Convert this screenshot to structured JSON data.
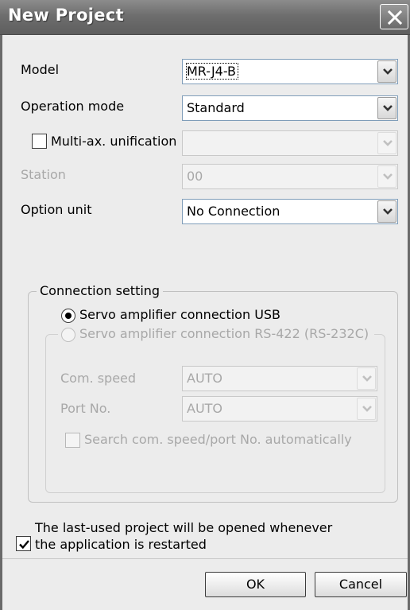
{
  "dialog": {
    "title": "New Project"
  },
  "fields": {
    "model": {
      "label": "Model",
      "value": "MR-J4-B"
    },
    "operation_mode": {
      "label": "Operation mode",
      "value": "Standard"
    },
    "multi_axis": {
      "label": "Multi-ax. unification",
      "checked": false,
      "value": ""
    },
    "station": {
      "label": "Station",
      "value": "00"
    },
    "option_unit": {
      "label": "Option unit",
      "value": "No Connection"
    }
  },
  "connection": {
    "group_title": "Connection setting",
    "usb_label": "Servo amplifier connection USB",
    "rs422_label": "Servo amplifier connection RS-422 (RS-232C)",
    "com_speed": {
      "label": "Com. speed",
      "value": "AUTO"
    },
    "port_no": {
      "label": "Port No.",
      "value": "AUTO"
    },
    "auto_search_label": "Search com. speed/port No. automatically"
  },
  "reopen": {
    "line1": "The last-used project will be opened whenever",
    "line2": "the application is restarted",
    "checked": true
  },
  "buttons": {
    "ok": "OK",
    "cancel": "Cancel"
  }
}
